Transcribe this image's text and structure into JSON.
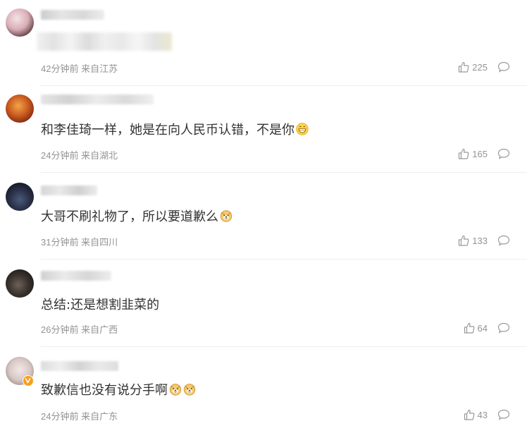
{
  "comments": [
    {
      "text": "",
      "time": "42分钟前",
      "location": "来自江苏",
      "likes": "225"
    },
    {
      "text": "和李佳琦一样，她是在向人民币认错，不是你",
      "emoji": "grin-emoji",
      "time": "24分钟前",
      "location": "来自湖北",
      "likes": "165"
    },
    {
      "text": "大哥不刷礼物了，所以要道歉么",
      "emoji": "doge-emoji",
      "time": "31分钟前",
      "location": "来自四川",
      "likes": "133"
    },
    {
      "text": "总结:还是想割韭菜的",
      "time": "26分钟前",
      "location": "来自广西",
      "likes": "64"
    },
    {
      "text": "致歉信也没有说分手啊",
      "emoji": "doge-emoji",
      "time": "24分钟前",
      "location": "来自广东",
      "likes": "43"
    }
  ],
  "icons": {
    "like": "thumbs-up-icon",
    "reply": "comment-bubble-icon",
    "verified": "verified-badge-icon"
  },
  "colors": {
    "text": "#333333",
    "meta": "#939393",
    "divider": "#eeeeee",
    "verified_badge": "#f79f1f"
  }
}
